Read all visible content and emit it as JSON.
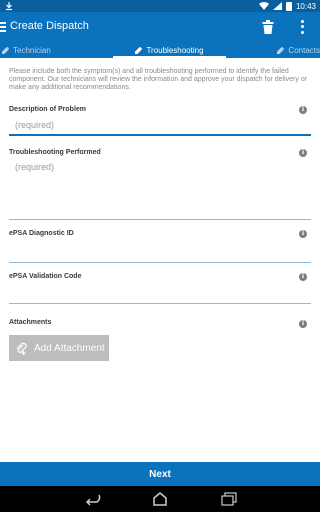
{
  "status": {
    "time": "10:43"
  },
  "app_bar": {
    "title": "Create Dispatch"
  },
  "tabs": [
    {
      "label": "Technician"
    },
    {
      "label": "Troubleshooting"
    },
    {
      "label": "Contacts"
    }
  ],
  "intro_text": "Please include both the symptom(s) and all troubleshooting performed to identify the failed component. Our technicians will review the information and approve your dispatch for delivery or make any additional recommendations.",
  "fields": {
    "description": {
      "label": "Description of Problem",
      "placeholder": "(required)"
    },
    "troubleshooting": {
      "label": "Troubleshooting Performed",
      "placeholder": "(required)"
    },
    "epsa_id": {
      "label": "ePSA Diagnostic ID",
      "placeholder": ""
    },
    "epsa_code": {
      "label": "ePSA Validation Code",
      "placeholder": ""
    }
  },
  "attachments": {
    "label": "Attachments",
    "button_label": "Add Attachment"
  },
  "next_label": "Next",
  "colors": {
    "primary": "#0b72bd",
    "status_bar": "#0b5e9c",
    "disabled_button": "#bdbdbd"
  },
  "icons": [
    "menu-icon",
    "trash-icon",
    "overflow-icon",
    "pencil-icon",
    "info-icon",
    "paperclip-icon",
    "back-icon",
    "home-icon",
    "recents-icon",
    "wifi-icon",
    "signal-icon",
    "battery-icon"
  ]
}
